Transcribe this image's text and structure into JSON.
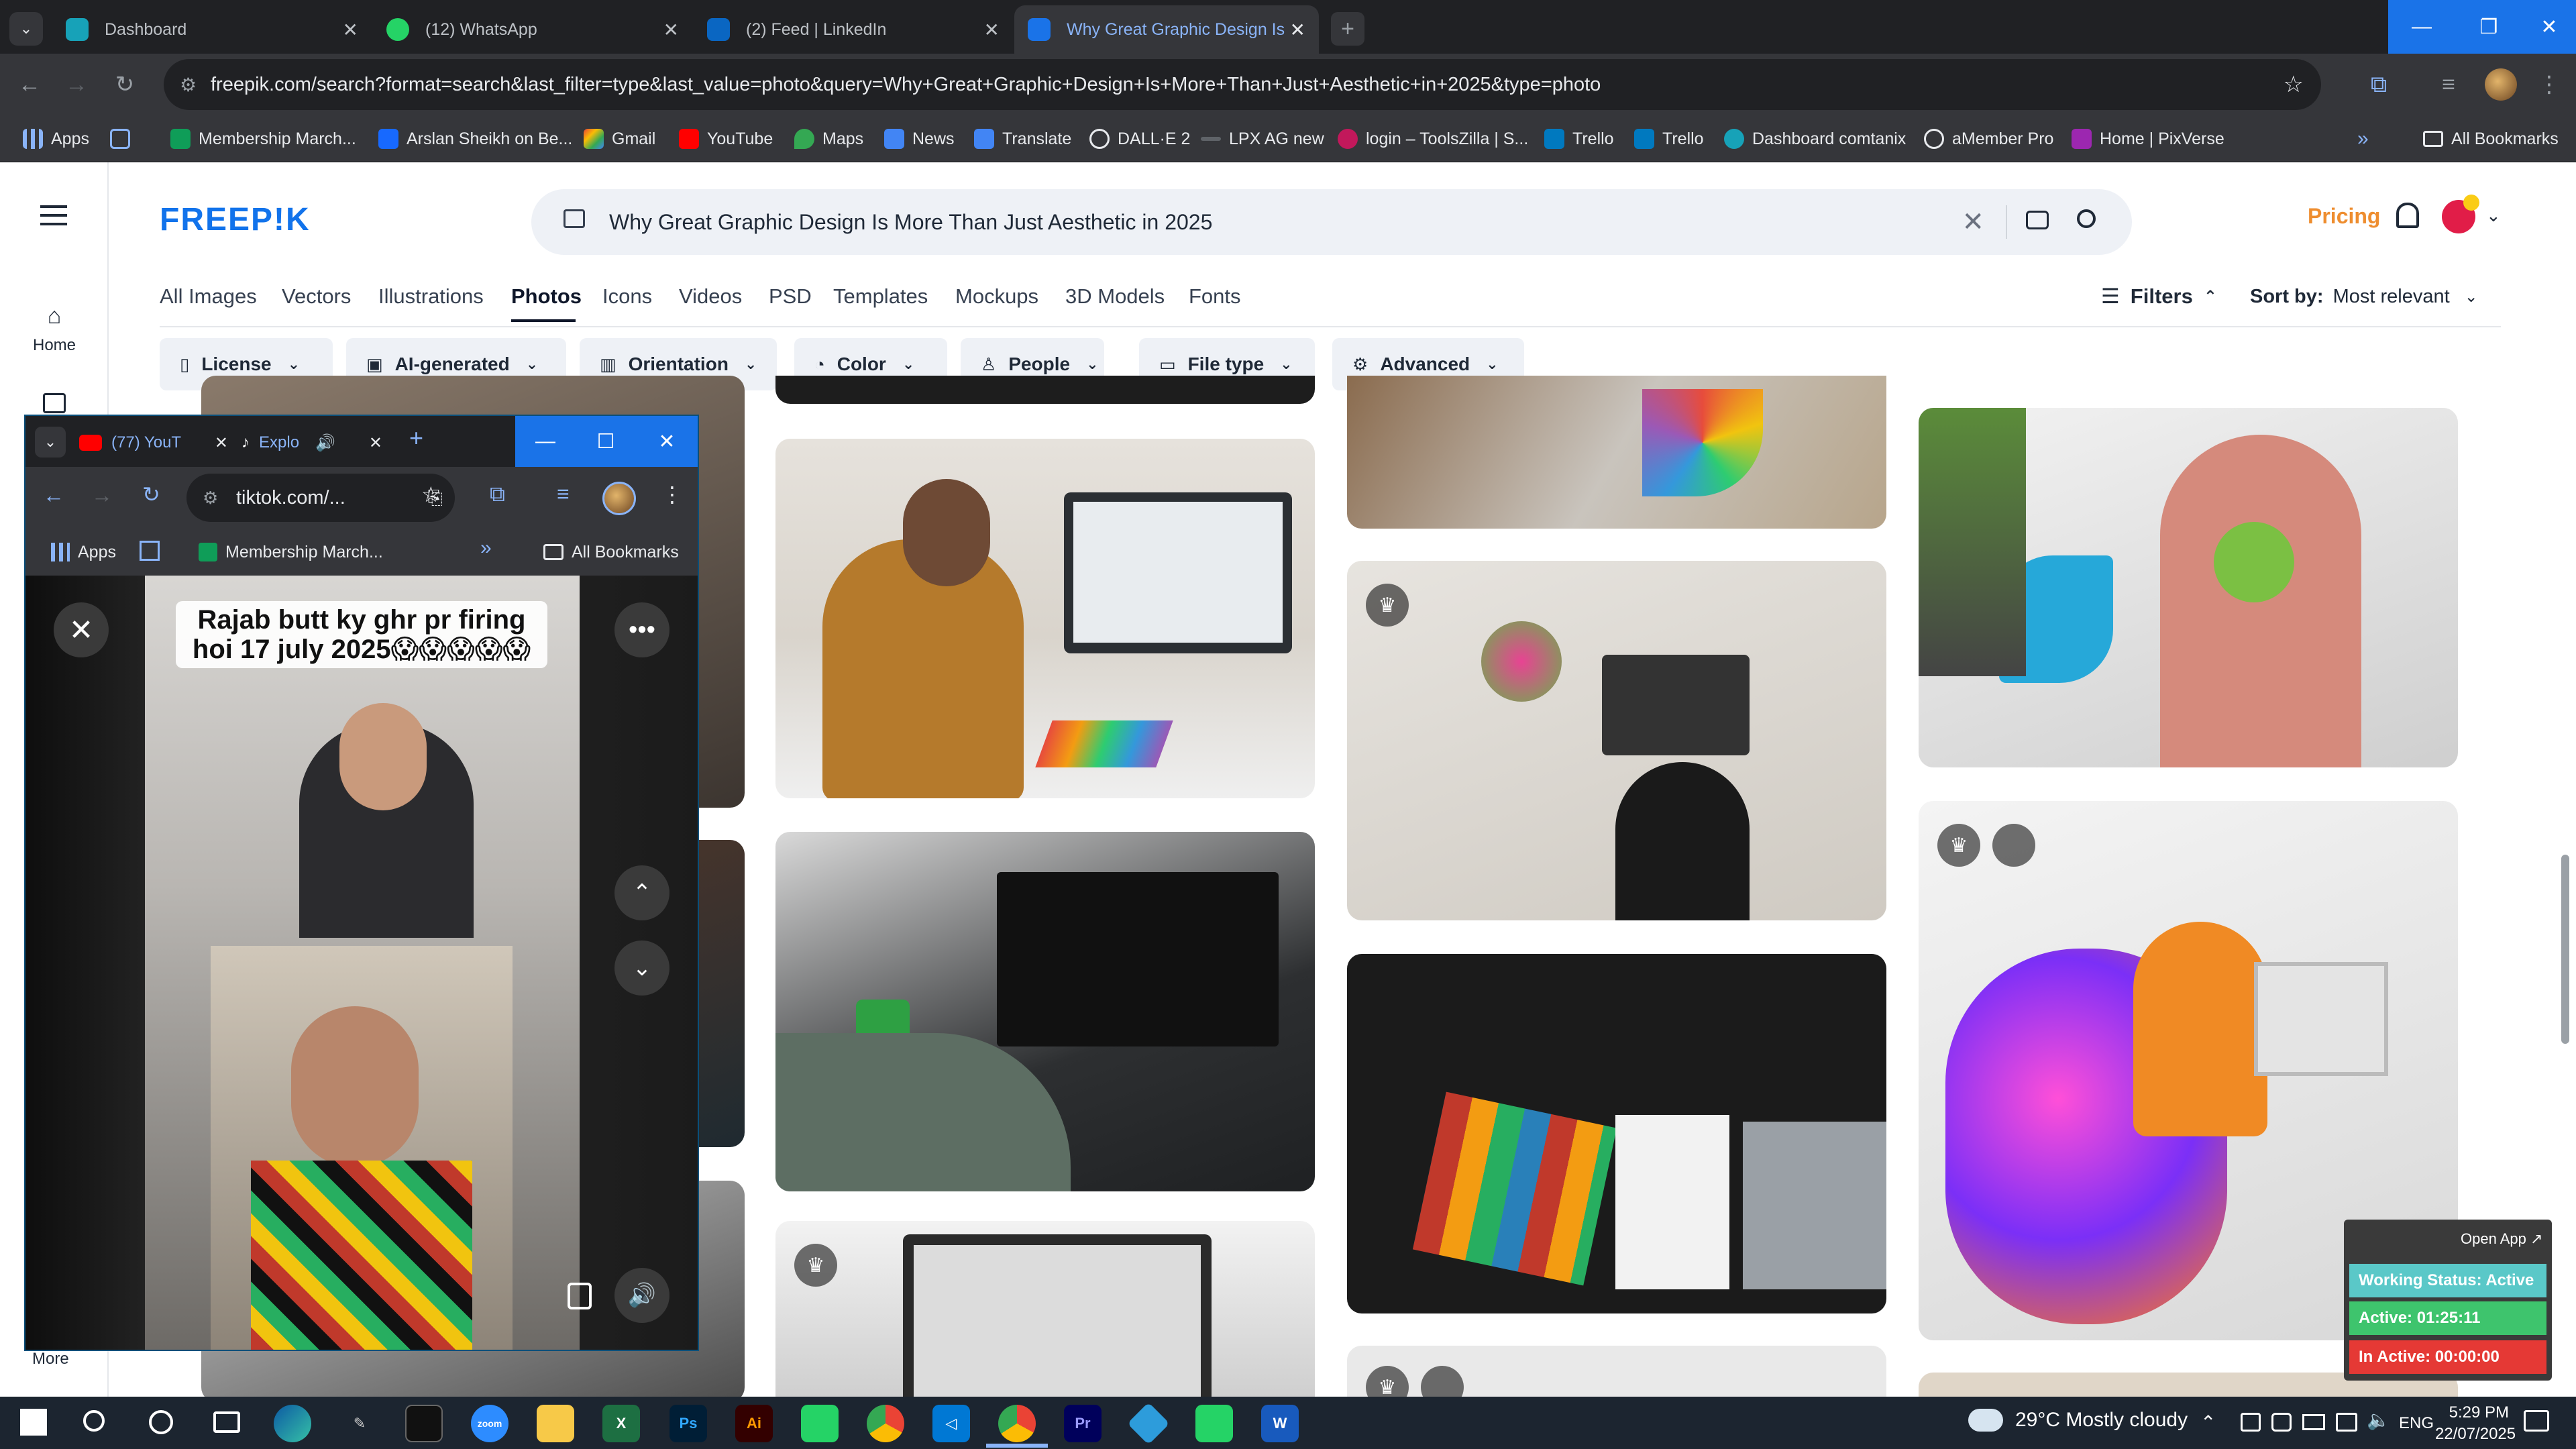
{
  "chrome": {
    "tabs": [
      {
        "label": "Dashboard",
        "fav": "#17a2b8"
      },
      {
        "label": "(12) WhatsApp",
        "fav": "#25d366"
      },
      {
        "label": "(2) Feed | LinkedIn",
        "fav": "#0a66c2"
      },
      {
        "label": "Why Great Graphic Design Is M",
        "fav": "#1a73e8"
      }
    ],
    "url": "freepik.com/search?format=search&last_filter=type&last_value=photo&query=Why+Great+Graphic+Design+Is+More+Than+Just+Aesthetic+in+2025&type=photo",
    "bookmarks": [
      "Apps",
      "Membership March...",
      "Arslan Sheikh on Be...",
      "Gmail",
      "YouTube",
      "Maps",
      "News",
      "Translate",
      "DALL·E 2",
      "LPX AG new",
      "login – ToolsZilla | S...",
      "Trello",
      "Trello",
      "Dashboard comtanix",
      "aMember Pro",
      "Home | PixVerse"
    ],
    "all_bookmarks": "All Bookmarks"
  },
  "freepik": {
    "logo": "FREEP!K",
    "search_value": "Why Great Graphic Design Is More Than Just Aesthetic in 2025",
    "pricing": "Pricing",
    "sidebar": {
      "home": "Home",
      "more": "More"
    },
    "categories": [
      "All Images",
      "Vectors",
      "Illustrations",
      "Photos",
      "Icons",
      "Videos",
      "PSD",
      "Templates",
      "Mockups",
      "3D Models",
      "Fonts"
    ],
    "active_category": "Photos",
    "filters_label": "Filters",
    "sort_label": "Sort by:",
    "sort_value": "Most relevant",
    "filter_chips": [
      "License",
      "AI-generated",
      "Orientation",
      "Color",
      "People",
      "File type",
      "Advanced"
    ]
  },
  "tiktok": {
    "tabs": [
      "(77) YouT",
      "Explo"
    ],
    "url": "tiktok.com/...",
    "bookmarks": [
      "Apps",
      "Membership March..."
    ],
    "all_bookmarks": "All Bookmarks",
    "caption_line1": "Rajab butt ky ghr pr firing",
    "caption_line2": "hoi 17 july 2025😱😱😱😱😱"
  },
  "work_status": {
    "open_app": "Open App ↗",
    "status": "Working Status: Active",
    "active": "Active: 01:25:11",
    "inactive": "In Active: 00:00:00"
  },
  "taskbar": {
    "weather": "29°C  Mostly cloudy",
    "lang": "ENG",
    "time": "5:29 PM",
    "date": "22/07/2025"
  }
}
